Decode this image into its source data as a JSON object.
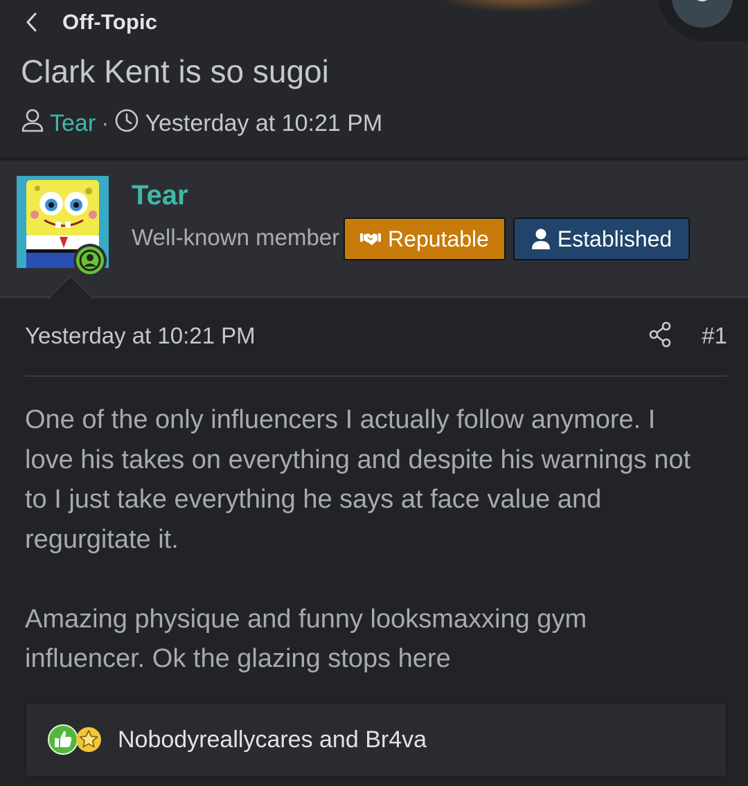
{
  "header": {
    "breadcrumb": "Off-Topic",
    "thread_title": "Clark Kent is so sugoi",
    "author": "Tear",
    "separator": "·",
    "posted_time": "Yesterday at 10:21 PM"
  },
  "user": {
    "username": "Tear",
    "title": "Well-known member",
    "badges": [
      {
        "label": "Reputable",
        "color": "#c77b0a",
        "icon": "handshake-icon"
      },
      {
        "label": "Established",
        "color": "#20446b",
        "icon": "user-icon"
      }
    ],
    "online_status_color": "#6cbf3a"
  },
  "post": {
    "date": "Yesterday at 10:21 PM",
    "number": "#1",
    "paragraphs": [
      "One of the only influencers I actually follow anymore. I love his takes on everything and despite his warnings not to I just take everything he says at face value and regurgitate it.",
      "Amazing physique and funny looksmaxxing gym influencer. Ok the glazing stops here"
    ]
  },
  "reactions": {
    "icons": [
      "thumbs-up-icon",
      "star-icon"
    ],
    "text": "Nobodyreallycares and Br4va"
  },
  "colors": {
    "accent": "#3fb8a9",
    "background": "#222327"
  }
}
